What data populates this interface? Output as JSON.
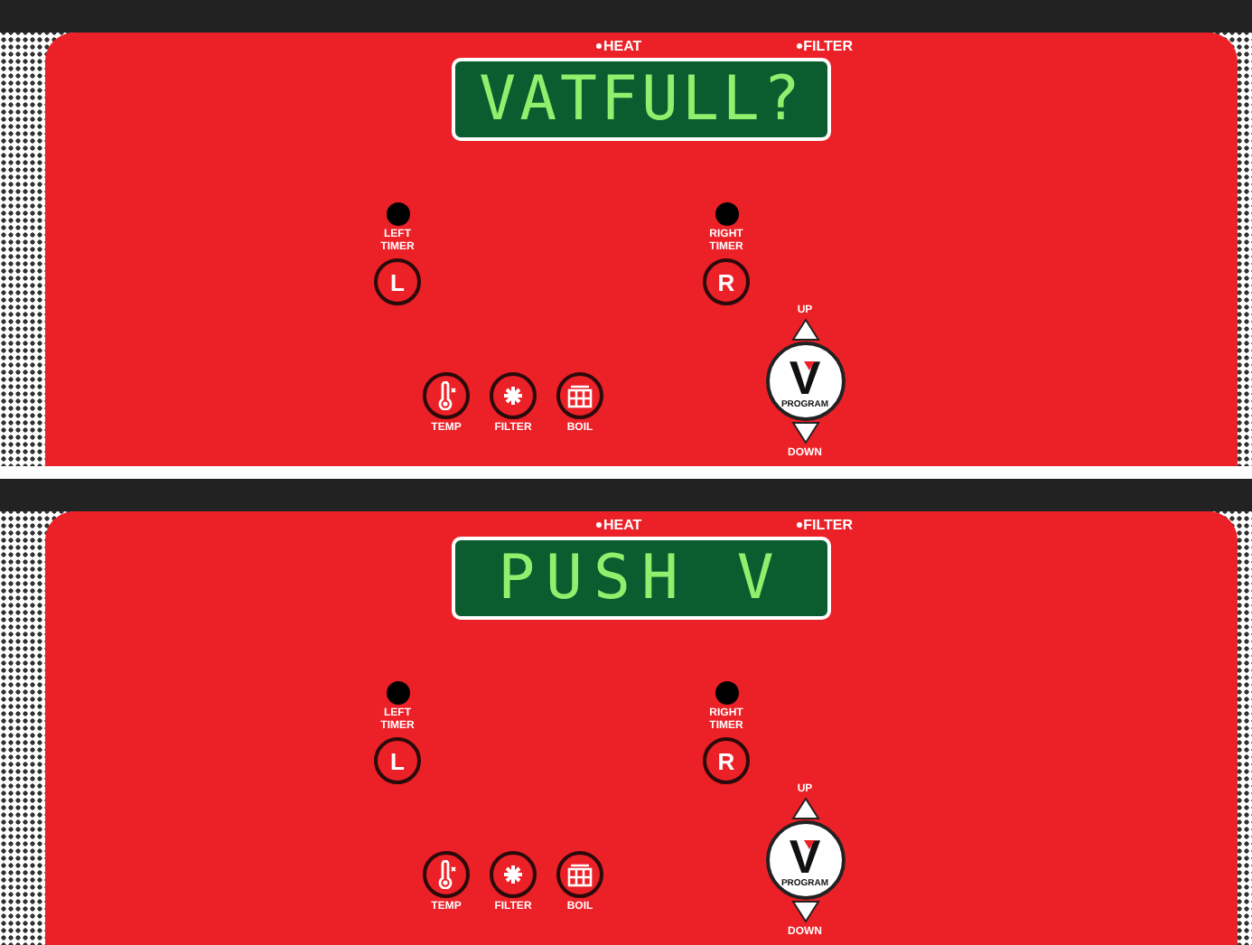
{
  "panels": [
    {
      "indicators": [
        {
          "label": "HEAT"
        },
        {
          "label": "FILTER"
        }
      ],
      "display": "VATFULL?",
      "timers": [
        {
          "label": "LEFT TIMER",
          "key": "L"
        },
        {
          "label": "RIGHT TIMER",
          "key": "R"
        }
      ],
      "function_buttons": [
        {
          "kind": "temp",
          "label": "TEMP"
        },
        {
          "kind": "filter",
          "label": "FILTER"
        },
        {
          "kind": "boil",
          "label": "BOIL"
        }
      ],
      "program": {
        "up": "UP",
        "key": "V",
        "label": "PROGRAM",
        "down": "DOWN"
      }
    },
    {
      "indicators": [
        {
          "label": "HEAT"
        },
        {
          "label": "FILTER"
        }
      ],
      "display": "PUSH V",
      "timers": [
        {
          "label": "LEFT TIMER",
          "key": "L"
        },
        {
          "label": "RIGHT TIMER",
          "key": "R"
        }
      ],
      "function_buttons": [
        {
          "kind": "temp",
          "label": "TEMP"
        },
        {
          "kind": "filter",
          "label": "FILTER"
        },
        {
          "kind": "boil",
          "label": "BOIL"
        }
      ],
      "program": {
        "up": "UP",
        "key": "V",
        "label": "PROGRAM",
        "down": "DOWN"
      }
    }
  ]
}
